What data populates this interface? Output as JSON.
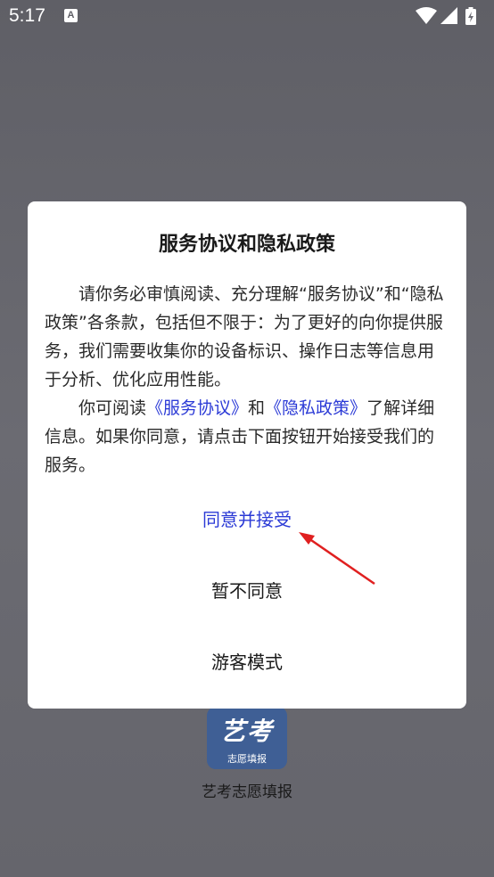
{
  "status_bar": {
    "time": "5:17",
    "notification_icon_letter": "A",
    "icons": [
      "wifi-icon",
      "signal-icon",
      "battery-icon"
    ]
  },
  "background_app": {
    "logo_chars": "艺考",
    "logo_subtitle": "志愿填报",
    "app_name": "艺考志愿填报",
    "logo_color": "#3f5f95"
  },
  "dialog": {
    "title": "服务协议和隐私政策",
    "paragraph1": "请你务必审慎阅读、充分理解“服务协议”和“隐私政策”各条款，包括但不限于：为了更好的向你提供服务，我们需要收集你的设备标识、操作日志等信息用于分析、优化应用性能。",
    "paragraph2_prefix": "你可阅读",
    "service_link": "《服务协议》",
    "paragraph2_and": "和",
    "privacy_link": "《隐私政策》",
    "paragraph2_suffix": "了解详细信息。如果你同意，请点击下面按钮开始接受我们的服务。",
    "buttons": {
      "accept": "同意并接受",
      "decline": "暂不同意",
      "guest": "游客模式"
    },
    "link_color": "#2b3ad6"
  },
  "annotation": {
    "arrow_color": "#e02020"
  }
}
